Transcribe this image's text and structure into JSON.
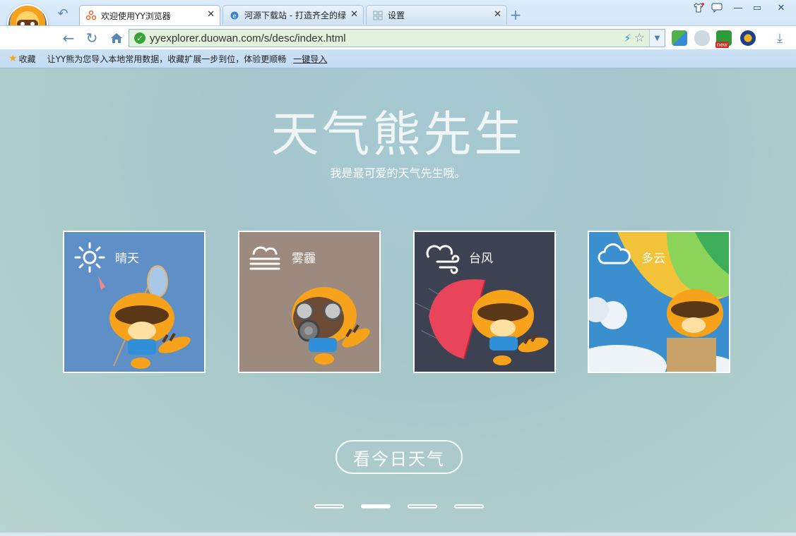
{
  "browser": {
    "tabs": [
      {
        "title": "欢迎使用YY浏览器",
        "active": true
      },
      {
        "title": "河源下载站 - 打造齐全的绿",
        "active": false
      },
      {
        "title": "设置",
        "active": false
      }
    ],
    "newtab_label": "+",
    "address_url": "yyexplorer.duowan.com/s/desc/index.html",
    "bookmarks_label": "收藏",
    "import_message": "让YY熊为您导入本地常用数据，收藏扩展一步到位，体验更顺畅",
    "import_link": "一键导入"
  },
  "page": {
    "title": "天气熊先生",
    "subtitle": "我是最可爱的天气先生哦。",
    "cards": [
      {
        "label": "晴天",
        "icon": "sun-icon",
        "bg": "#5e8fc6"
      },
      {
        "label": "雾霾",
        "icon": "fog-icon",
        "bg": "#9c8a7e"
      },
      {
        "label": "台风",
        "icon": "typhoon-icon",
        "bg": "#3d4253"
      },
      {
        "label": "多云",
        "icon": "cloud-icon",
        "bg": "#3c8fcf"
      }
    ],
    "cta_label": "看今日天气",
    "pager_active": 2,
    "pager_count": 4
  },
  "colors": {
    "accent": "#4f7dab",
    "address_bg": "#e2f2dc"
  }
}
